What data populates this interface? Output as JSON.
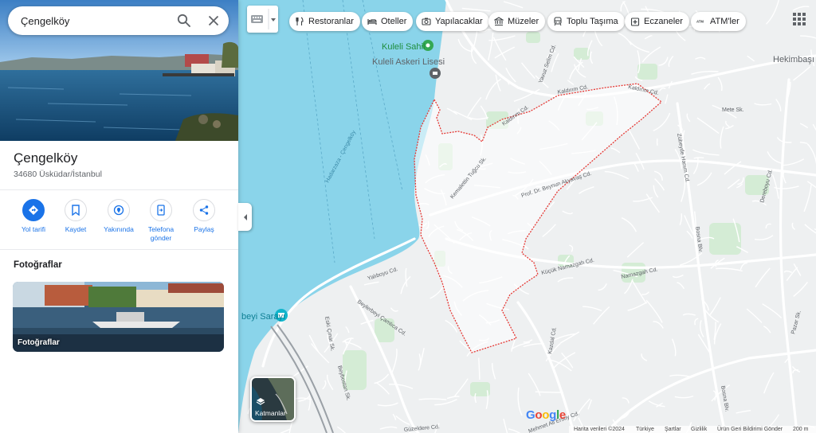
{
  "search": {
    "value": "Çengelköy",
    "search_icon": "search-icon",
    "close_icon": "close-icon"
  },
  "place": {
    "title": "Çengelköy",
    "address": "34680 Üsküdar/İstanbul"
  },
  "actions": [
    {
      "label": "Yol tarifi",
      "icon": "directions-icon"
    },
    {
      "label": "Kaydet",
      "icon": "bookmark-icon"
    },
    {
      "label": "Yakınında",
      "icon": "nearby-icon"
    },
    {
      "label": "Telefona gönder",
      "icon": "send-to-phone-icon"
    },
    {
      "label": "Paylaş",
      "icon": "share-icon"
    }
  ],
  "photos": {
    "heading": "Fotoğraflar",
    "card_label": "Fotoğraflar"
  },
  "chips": [
    {
      "label": "Restoranlar",
      "icon": "restaurant-icon"
    },
    {
      "label": "Oteller",
      "icon": "hotel-icon"
    },
    {
      "label": "Yapılacaklar",
      "icon": "camera-icon"
    },
    {
      "label": "Müzeler",
      "icon": "museum-icon"
    },
    {
      "label": "Toplu Taşıma",
      "icon": "transit-icon"
    },
    {
      "label": "Eczaneler",
      "icon": "pharmacy-icon"
    },
    {
      "label": "ATM'ler",
      "icon": "atm-icon"
    }
  ],
  "map_labels": {
    "kuleli_sahil": "Kuleli Sahil",
    "kuleli_askeri": "Kuleli Askeri Lisesi",
    "hekimbasi": "Hekimbaşı",
    "beylerbeyi_sarayi": "beyi Sarayı",
    "hadika": "Hadarzaza - Çengelköy",
    "kaldirim_cd": "Kaldırım Cd.",
    "kaldirim_cd2": "Kaldırım Cd.",
    "kaldirim_cd3": "Kaldırım Cd.",
    "kemalettin": "Kemalettin Tuğcu Sk.",
    "beynun": "Prof. Dr. Beynun Akyavaş Cd.",
    "kucuk_namazgah": "Küçük Namazgah Cd.",
    "namazgah": "Namazgah Cd.",
    "yalibolu": "Yalıboyu Cd.",
    "beylerbeyi_camlica": "Beylerbeyi Çamlıca Cd.",
    "mete": "Mete Sk.",
    "zubeyde": "Zübeyde Hanım Cd.",
    "dereboyu": "Dereboyu Cd.",
    "bosna": "Bosna Blv.",
    "bosna2": "Bosna Blv.",
    "kazdal": "Kazdal Cd.",
    "eski_cinar": "Eski Çınar Sk.",
    "beybostan": "Beybostan Sk.",
    "mehmet_ali": "Mehmet Ali Ersoy Cd.",
    "guzeldere": "Güzeldere Cd.",
    "pazar": "Pazar Sk.",
    "yavuz_selim": "Yavuz Selim Cd."
  },
  "layers": {
    "label": "Katmanlar",
    "icon": "layers-icon"
  },
  "google_logo": "Google",
  "footer": {
    "data": "Harita verileri ©2024",
    "country": "Türkiye",
    "terms": "Şartlar",
    "privacy": "Gizlilik",
    "feedback": "Ürün Geri Bildirimi Gönder",
    "scale": "200 m"
  },
  "colors": {
    "water": "#8ad4ea",
    "land": "#f1f3f4",
    "road": "#ffffff",
    "boundary": "#e53935",
    "accent": "#1a73e8",
    "park": "#c6e8c9"
  }
}
